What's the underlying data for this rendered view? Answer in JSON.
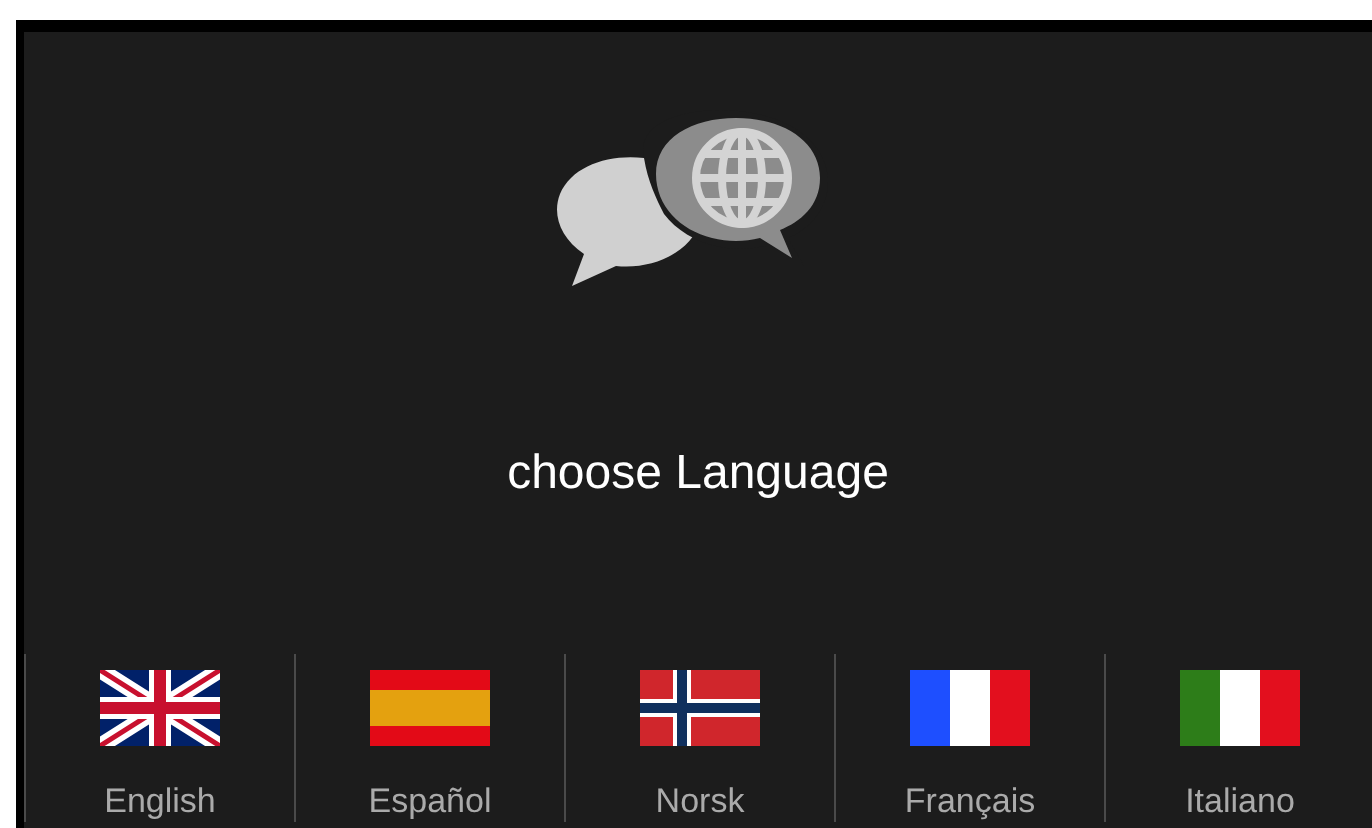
{
  "title": "choose Language",
  "languages": [
    {
      "label": "English",
      "kind": "uk"
    },
    {
      "label": "Español",
      "kind": "es"
    },
    {
      "label": "Norsk",
      "kind": "no"
    },
    {
      "label": "Français",
      "kind": "fr"
    },
    {
      "label": "Italiano",
      "kind": "it"
    }
  ]
}
